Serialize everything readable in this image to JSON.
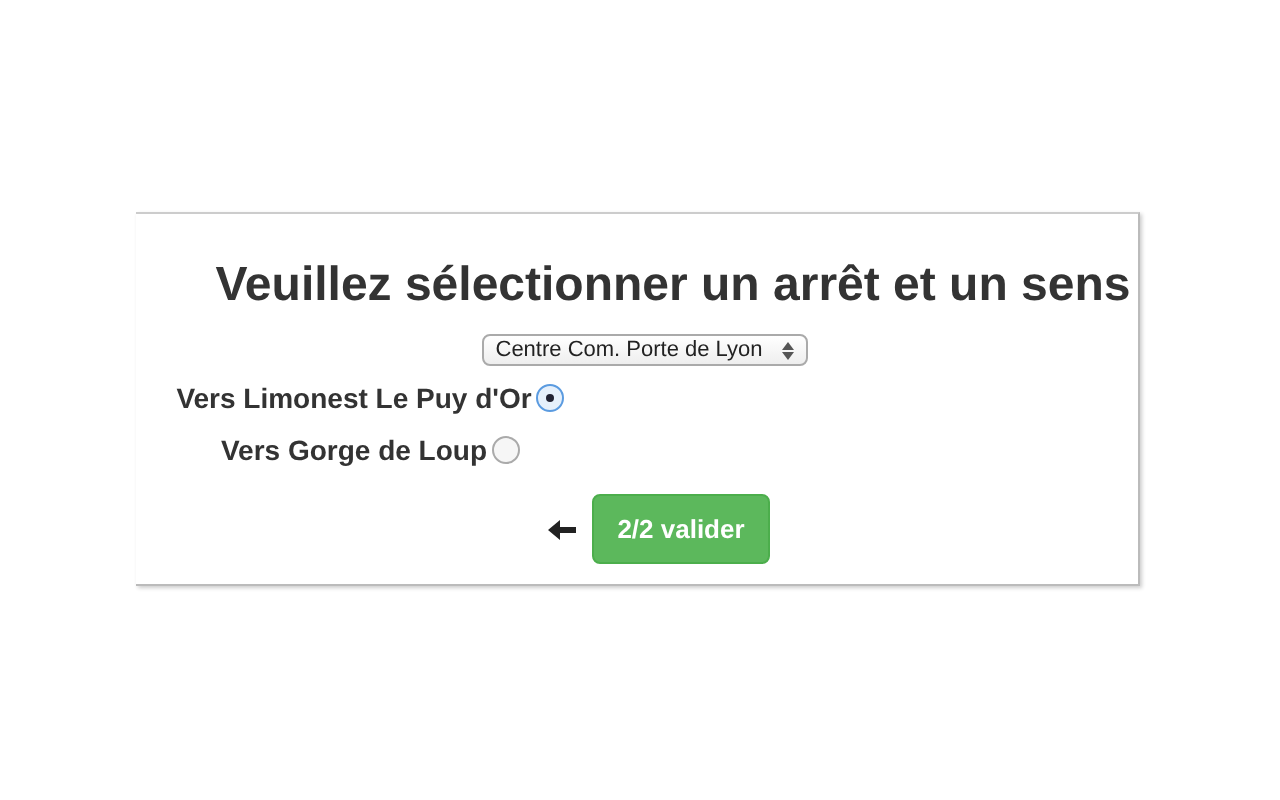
{
  "title": "Veuillez sélectionner un arrêt et un sens",
  "stop_select": {
    "value": "Centre Com. Porte de Lyon"
  },
  "directions": [
    {
      "label": "Vers Limonest Le Puy d'Or",
      "selected": true
    },
    {
      "label": "Vers Gorge de Loup",
      "selected": false
    }
  ],
  "submit_button": "2/2 valider"
}
